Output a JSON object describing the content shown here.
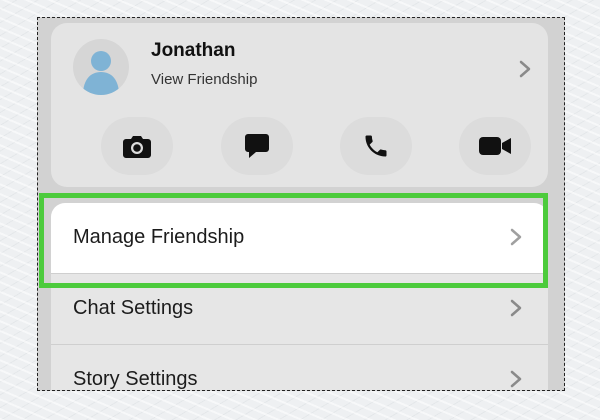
{
  "profile": {
    "name": "Jonathan",
    "subtitle": "View Friendship",
    "avatar_icon": "person-silhouette-icon",
    "chevron_icon": "chevron-right-icon"
  },
  "actions": [
    {
      "icon": "camera-icon"
    },
    {
      "icon": "chat-bubble-icon"
    },
    {
      "icon": "phone-icon"
    },
    {
      "icon": "video-camera-icon"
    }
  ],
  "settings": {
    "manage_friendship": "Manage Friendship",
    "chat_settings": "Chat Settings",
    "story_settings": "Story Settings"
  },
  "colors": {
    "highlight": "#4ccb3c",
    "avatar": "#7fb3d5",
    "card_background": "#e4e4e4",
    "dimmed_background": "#d2d2d2"
  }
}
